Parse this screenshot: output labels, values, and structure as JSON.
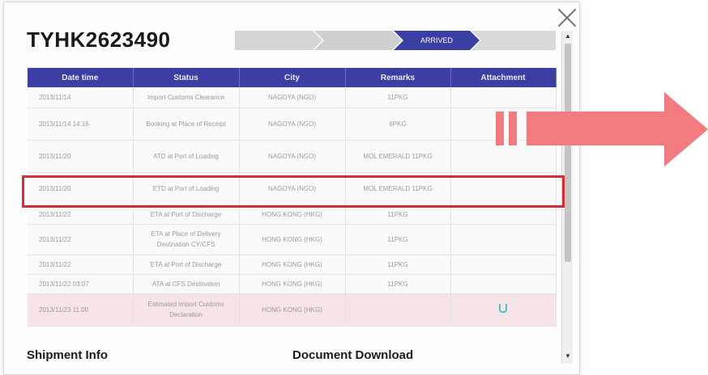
{
  "shipment": {
    "number": "TYHK2623490"
  },
  "progress": {
    "steps": [
      {
        "label": "",
        "state": "done"
      },
      {
        "label": "",
        "state": "done"
      },
      {
        "label": "ARRIVED",
        "state": "current"
      },
      {
        "label": "",
        "state": "pending"
      }
    ]
  },
  "table": {
    "headers": [
      "Date time",
      "Status",
      "City",
      "Remarks",
      "Attachment"
    ],
    "rows": [
      {
        "date": "2013/11/14",
        "status": "Import Customs Clearance",
        "city": "NAGOYA (NGO)",
        "remarks": "11PKG",
        "attachment": ""
      },
      {
        "date": "2013/11/14 14:16",
        "status": "Booking at Place of Receipt",
        "city": "NAGOYA (NGO)",
        "remarks": "6PKG",
        "attachment": ""
      },
      {
        "date": "2013/11/20",
        "status": "ATD at Port of Loading",
        "city": "NAGOYA (NGO)",
        "remarks": "MOL EMERALD 11PKG",
        "attachment": ""
      },
      {
        "date": "2013/11/20",
        "status": "ETD at Port of Loading",
        "city": "NAGOYA (NGO)",
        "remarks": "MOL EMERALD 11PKG",
        "attachment": ""
      },
      {
        "date": "2013/11/22",
        "status": "ETA at Port of Discharge",
        "city": "HONG KONG (HKG)",
        "remarks": "11PKG",
        "attachment": ""
      },
      {
        "date": "2013/11/22",
        "status": "ETA at Place of Delivery Destination CY/CFS",
        "city": "HONG KONG (HKG)",
        "remarks": "11PKG",
        "attachment": ""
      },
      {
        "date": "2013/11/22",
        "status": "ETA at Port of Discharge",
        "city": "HONG KONG (HKG)",
        "remarks": "11PKG",
        "attachment": ""
      },
      {
        "date": "2013/11/22 03:07",
        "status": "ATA at CFS Destination",
        "city": "HONG KONG (HKG)",
        "remarks": "11PKG",
        "attachment": ""
      },
      {
        "date": "2013/11/23 11:00",
        "status": "Estimated Import Customs Declaration",
        "city": "HONG KONG (HKG)",
        "remarks": "",
        "attachment": "paperclip-icon"
      }
    ]
  },
  "sections": {
    "shipment_info": "Shipment Info",
    "document_download": "Document Download"
  },
  "colors": {
    "accent": "#3b3fa4",
    "highlight": "#d92b33",
    "arrow": "#f27b80"
  }
}
